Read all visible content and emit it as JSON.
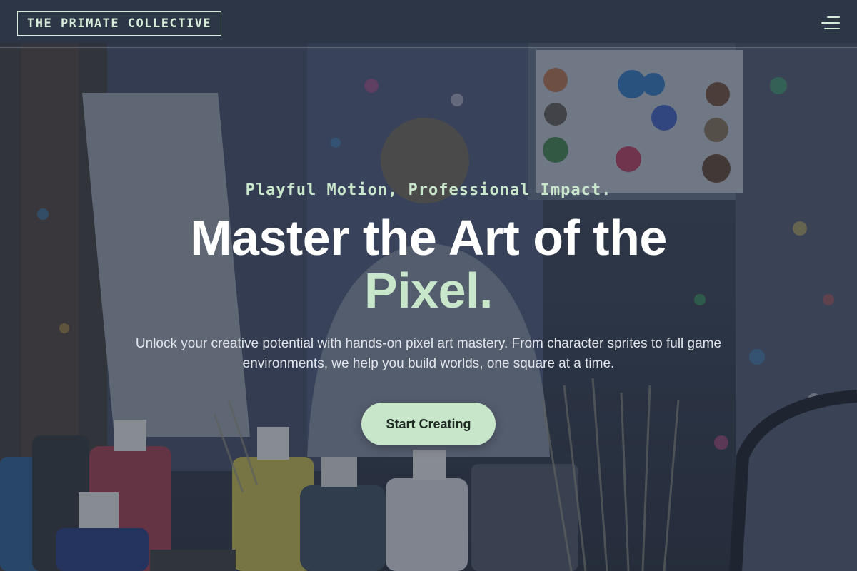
{
  "header": {
    "logo_text": "THE PRIMATE COLLECTIVE",
    "menu_icon": "hamburger-menu-icon"
  },
  "hero": {
    "tagline": "Playful Motion, Professional Impact.",
    "headline": "Master the Art of the",
    "headline_accent": "Pixel.",
    "description": "Unlock your creative potential with hands-on pixel art mastery. From character sprites to full game environments, we help you build worlds, one square at a time.",
    "cta_label": "Start Creating",
    "background_image": "art-studio-photo"
  },
  "colors": {
    "accent": "#c8e6c9",
    "overlay": "#262e3e",
    "text": "#ffffff",
    "cta_text": "#1f2a24"
  }
}
